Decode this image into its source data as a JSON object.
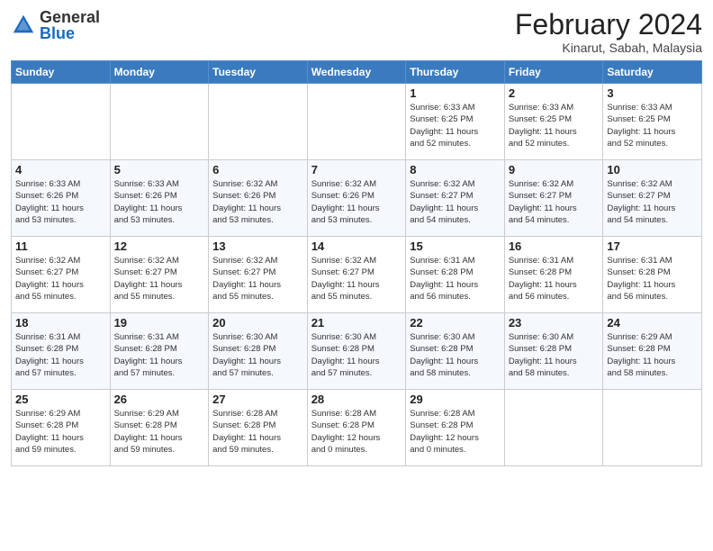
{
  "header": {
    "logo_general": "General",
    "logo_blue": "Blue",
    "month_title": "February 2024",
    "subtitle": "Kinarut, Sabah, Malaysia"
  },
  "weekdays": [
    "Sunday",
    "Monday",
    "Tuesday",
    "Wednesday",
    "Thursday",
    "Friday",
    "Saturday"
  ],
  "weeks": [
    [
      {
        "day": "",
        "info": ""
      },
      {
        "day": "",
        "info": ""
      },
      {
        "day": "",
        "info": ""
      },
      {
        "day": "",
        "info": ""
      },
      {
        "day": "1",
        "info": "Sunrise: 6:33 AM\nSunset: 6:25 PM\nDaylight: 11 hours\nand 52 minutes."
      },
      {
        "day": "2",
        "info": "Sunrise: 6:33 AM\nSunset: 6:25 PM\nDaylight: 11 hours\nand 52 minutes."
      },
      {
        "day": "3",
        "info": "Sunrise: 6:33 AM\nSunset: 6:25 PM\nDaylight: 11 hours\nand 52 minutes."
      }
    ],
    [
      {
        "day": "4",
        "info": "Sunrise: 6:33 AM\nSunset: 6:26 PM\nDaylight: 11 hours\nand 53 minutes."
      },
      {
        "day": "5",
        "info": "Sunrise: 6:33 AM\nSunset: 6:26 PM\nDaylight: 11 hours\nand 53 minutes."
      },
      {
        "day": "6",
        "info": "Sunrise: 6:32 AM\nSunset: 6:26 PM\nDaylight: 11 hours\nand 53 minutes."
      },
      {
        "day": "7",
        "info": "Sunrise: 6:32 AM\nSunset: 6:26 PM\nDaylight: 11 hours\nand 53 minutes."
      },
      {
        "day": "8",
        "info": "Sunrise: 6:32 AM\nSunset: 6:27 PM\nDaylight: 11 hours\nand 54 minutes."
      },
      {
        "day": "9",
        "info": "Sunrise: 6:32 AM\nSunset: 6:27 PM\nDaylight: 11 hours\nand 54 minutes."
      },
      {
        "day": "10",
        "info": "Sunrise: 6:32 AM\nSunset: 6:27 PM\nDaylight: 11 hours\nand 54 minutes."
      }
    ],
    [
      {
        "day": "11",
        "info": "Sunrise: 6:32 AM\nSunset: 6:27 PM\nDaylight: 11 hours\nand 55 minutes."
      },
      {
        "day": "12",
        "info": "Sunrise: 6:32 AM\nSunset: 6:27 PM\nDaylight: 11 hours\nand 55 minutes."
      },
      {
        "day": "13",
        "info": "Sunrise: 6:32 AM\nSunset: 6:27 PM\nDaylight: 11 hours\nand 55 minutes."
      },
      {
        "day": "14",
        "info": "Sunrise: 6:32 AM\nSunset: 6:27 PM\nDaylight: 11 hours\nand 55 minutes."
      },
      {
        "day": "15",
        "info": "Sunrise: 6:31 AM\nSunset: 6:28 PM\nDaylight: 11 hours\nand 56 minutes."
      },
      {
        "day": "16",
        "info": "Sunrise: 6:31 AM\nSunset: 6:28 PM\nDaylight: 11 hours\nand 56 minutes."
      },
      {
        "day": "17",
        "info": "Sunrise: 6:31 AM\nSunset: 6:28 PM\nDaylight: 11 hours\nand 56 minutes."
      }
    ],
    [
      {
        "day": "18",
        "info": "Sunrise: 6:31 AM\nSunset: 6:28 PM\nDaylight: 11 hours\nand 57 minutes."
      },
      {
        "day": "19",
        "info": "Sunrise: 6:31 AM\nSunset: 6:28 PM\nDaylight: 11 hours\nand 57 minutes."
      },
      {
        "day": "20",
        "info": "Sunrise: 6:30 AM\nSunset: 6:28 PM\nDaylight: 11 hours\nand 57 minutes."
      },
      {
        "day": "21",
        "info": "Sunrise: 6:30 AM\nSunset: 6:28 PM\nDaylight: 11 hours\nand 57 minutes."
      },
      {
        "day": "22",
        "info": "Sunrise: 6:30 AM\nSunset: 6:28 PM\nDaylight: 11 hours\nand 58 minutes."
      },
      {
        "day": "23",
        "info": "Sunrise: 6:30 AM\nSunset: 6:28 PM\nDaylight: 11 hours\nand 58 minutes."
      },
      {
        "day": "24",
        "info": "Sunrise: 6:29 AM\nSunset: 6:28 PM\nDaylight: 11 hours\nand 58 minutes."
      }
    ],
    [
      {
        "day": "25",
        "info": "Sunrise: 6:29 AM\nSunset: 6:28 PM\nDaylight: 11 hours\nand 59 minutes."
      },
      {
        "day": "26",
        "info": "Sunrise: 6:29 AM\nSunset: 6:28 PM\nDaylight: 11 hours\nand 59 minutes."
      },
      {
        "day": "27",
        "info": "Sunrise: 6:28 AM\nSunset: 6:28 PM\nDaylight: 11 hours\nand 59 minutes."
      },
      {
        "day": "28",
        "info": "Sunrise: 6:28 AM\nSunset: 6:28 PM\nDaylight: 12 hours\nand 0 minutes."
      },
      {
        "day": "29",
        "info": "Sunrise: 6:28 AM\nSunset: 6:28 PM\nDaylight: 12 hours\nand 0 minutes."
      },
      {
        "day": "",
        "info": ""
      },
      {
        "day": "",
        "info": ""
      }
    ]
  ]
}
